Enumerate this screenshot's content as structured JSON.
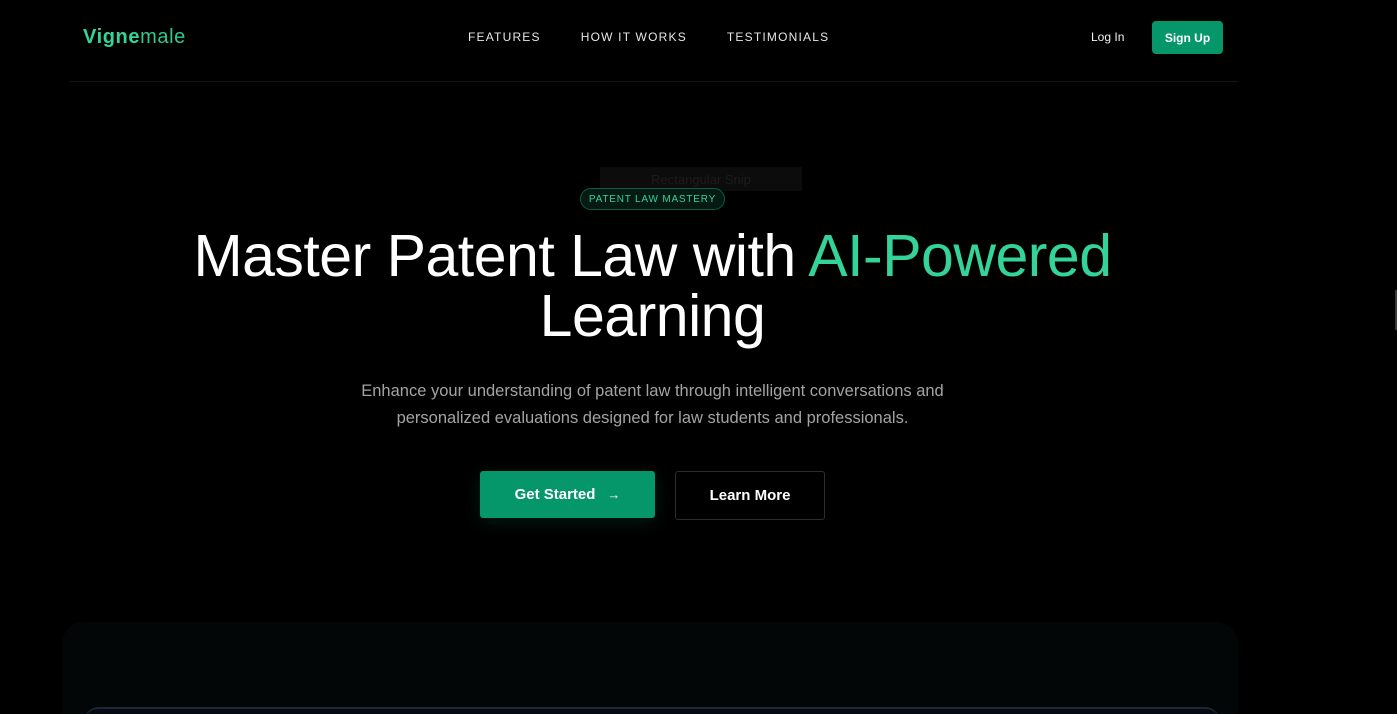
{
  "brand": {
    "part1": "Vigne",
    "part2": "male"
  },
  "nav": {
    "links": [
      "FEATURES",
      "HOW IT WORKS",
      "TESTIMONIALS"
    ],
    "login": "Log In",
    "signup": "Sign Up"
  },
  "hero": {
    "ghost_text": "Rectangular Snip",
    "badge": "PATENT LAW MASTERY",
    "headline_plain": "Master Patent Law with ",
    "headline_accent": "AI-Powered",
    "headline_line2": "Learning",
    "subtitle_line1": "Enhance your understanding of patent law through intelligent conversations and",
    "subtitle_line2": "personalized evaluations designed for law students and professionals.",
    "primary_cta": "Get Started",
    "primary_cta_icon": "→",
    "secondary_cta": "Learn More"
  },
  "colors": {
    "accent": "#34d399",
    "button": "#059669",
    "background": "#000000"
  }
}
